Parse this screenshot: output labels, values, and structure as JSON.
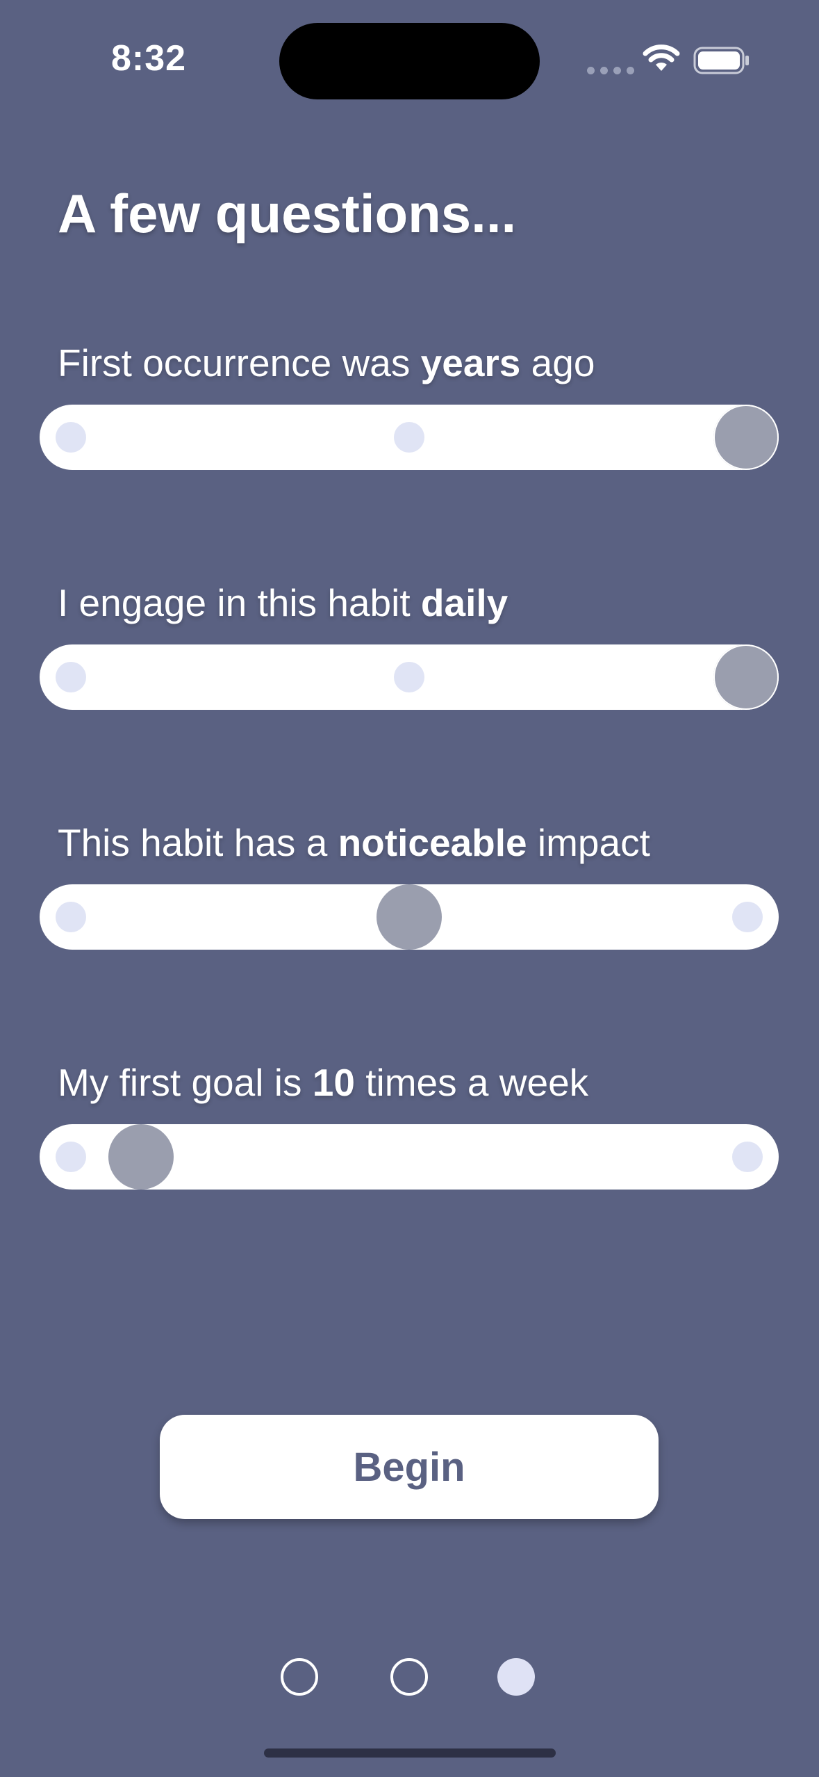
{
  "status_bar": {
    "time": "8:32"
  },
  "title": "A few questions...",
  "questions": [
    {
      "prefix": "First occurrence was ",
      "emphasis": "years",
      "suffix": " ago",
      "stops": 3,
      "selected_index": 2
    },
    {
      "prefix": "I engage in this habit ",
      "emphasis": "daily",
      "suffix": "",
      "stops": 3,
      "selected_index": 2
    },
    {
      "prefix": "This habit has a ",
      "emphasis": "noticeable",
      "suffix": " impact",
      "stops": 3,
      "selected_index": 1
    },
    {
      "prefix": "My first goal is ",
      "emphasis": "10",
      "suffix": " times a week",
      "stops": 2,
      "value_fraction": 0.1
    }
  ],
  "begin_label": "Begin",
  "pager": {
    "page_count": 3,
    "current_page": 3
  },
  "colors": {
    "background": "#5a6182",
    "thumb": "#9a9eae",
    "tick": "#e0e4f5",
    "button_text": "#5a6182"
  }
}
